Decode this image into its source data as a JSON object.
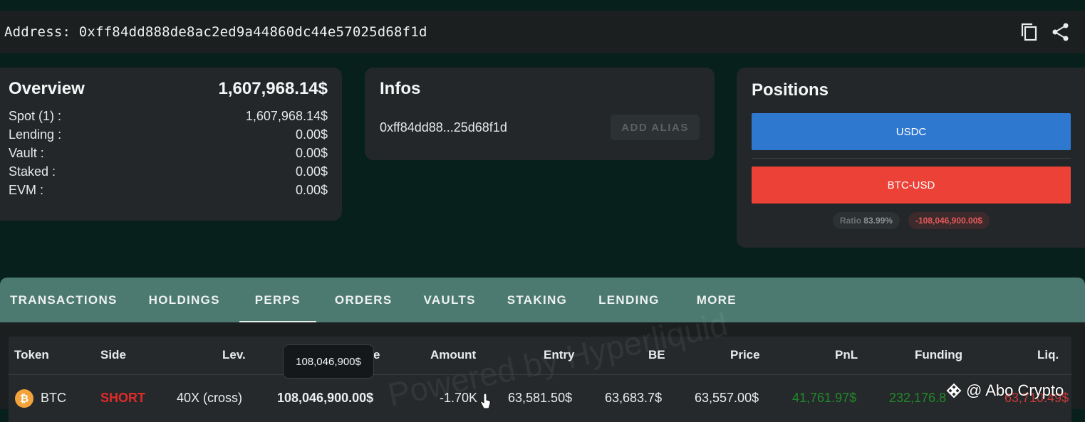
{
  "address_bar": {
    "text": "Address: 0xff84dd888de8ac2ed9a44860dc44e57025d68f1d",
    "copy_icon": "copy-icon",
    "share_icon": "share-icon"
  },
  "overview": {
    "title": "Overview",
    "total": "1,607,968.14$",
    "rows": [
      {
        "label": "Spot (1) :",
        "value": "1,607,968.14$"
      },
      {
        "label": "Lending :",
        "value": "0.00$"
      },
      {
        "label": "Vault :",
        "value": "0.00$"
      },
      {
        "label": "Staked :",
        "value": "0.00$"
      },
      {
        "label": "EVM :",
        "value": "0.00$"
      }
    ]
  },
  "infos": {
    "title": "Infos",
    "short_address": "0xff84dd88...25d68f1d",
    "add_alias_label": "ADD ALIAS"
  },
  "positions": {
    "title": "Positions",
    "usdc_label": "USDC",
    "btc_label": "BTC-USD",
    "ratio_label": "Ratio",
    "ratio_value": "83.99%",
    "pnl_badge": "-108,046,900.00$",
    "colors": {
      "usdc": "#2f78d0",
      "btc": "#ec4137"
    }
  },
  "tabs": [
    "TRANSACTIONS",
    "HOLDINGS",
    "PERPS",
    "ORDERS",
    "VAULTS",
    "STAKING",
    "LENDING",
    "MORE"
  ],
  "active_tab": "PERPS",
  "perps_table": {
    "headers": {
      "token": "Token",
      "side": "Side",
      "lev": "Lev.",
      "size": "e",
      "amount": "Amount",
      "entry": "Entry",
      "be": "BE",
      "price": "Price",
      "pnl": "PnL",
      "funding": "Funding",
      "liq": "Liq."
    },
    "row": {
      "token": "BTC",
      "token_icon": "bitcoin-icon",
      "side": "SHORT",
      "lev": "40X (cross)",
      "size": "108,046,900.00$",
      "amount": "-1.70K",
      "entry": "63,581.50$",
      "be": "63,683.7$",
      "price": "63,557.00$",
      "pnl": "41,761.97$",
      "funding": "232,176.8",
      "liq": "63,710.49$"
    },
    "colors": {
      "short": "#e02a2a",
      "positive": "#1f8a2a",
      "liq": "#c83a3a"
    }
  },
  "tooltip": "108,046,900$",
  "watermark": "Powered by Hyperliquid",
  "credit": "@ Abo Crypto"
}
